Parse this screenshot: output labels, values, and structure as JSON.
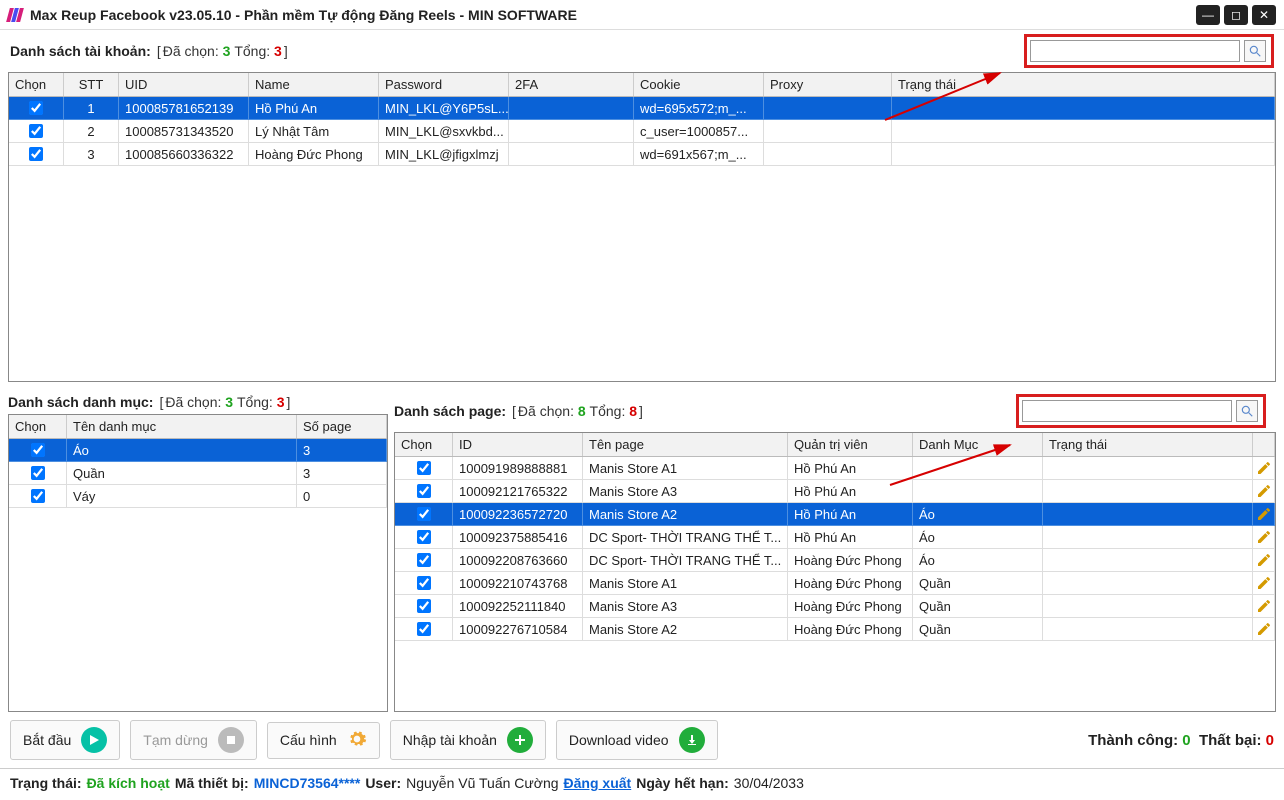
{
  "title": "Max Reup Facebook v23.05.10 - Phần mềm Tự động Đăng Reels - MIN SOFTWARE",
  "accounts_section": {
    "label": "Danh sách tài khoản:",
    "selected_label": "Đã chọn:",
    "selected_count": "3",
    "total_label": "Tổng:",
    "total_count": "3",
    "search_placeholder": ""
  },
  "accounts_headers": {
    "chon": "Chọn",
    "stt": "STT",
    "uid": "UID",
    "name": "Name",
    "password": "Password",
    "twofa": "2FA",
    "cookie": "Cookie",
    "proxy": "Proxy",
    "status": "Trạng thái"
  },
  "accounts": [
    {
      "stt": "1",
      "uid": "100085781652139",
      "name": "Hồ Phú An",
      "pass": "MIN_LKL@Y6P5sL...",
      "twofa": "",
      "cookie": "wd=695x572;m_...",
      "proxy": "",
      "status": "",
      "sel": true
    },
    {
      "stt": "2",
      "uid": "100085731343520",
      "name": "Lý Nhật Tâm",
      "pass": "MIN_LKL@sxvkbd...",
      "twofa": "",
      "cookie": "c_user=1000857...",
      "proxy": "",
      "status": "",
      "sel": false
    },
    {
      "stt": "3",
      "uid": "100085660336322",
      "name": "Hoàng Đức Phong",
      "pass": "MIN_LKL@jfigxlmzj",
      "twofa": "",
      "cookie": "wd=691x567;m_...",
      "proxy": "",
      "status": "",
      "sel": false
    }
  ],
  "cats_section": {
    "label": "Danh sách danh mục:",
    "selected_label": "Đã chọn:",
    "selected_count": "3",
    "total_label": "Tổng:",
    "total_count": "3"
  },
  "cats_headers": {
    "chon": "Chọn",
    "name": "Tên danh mục",
    "pages": "Số page"
  },
  "cats": [
    {
      "name": "Áo",
      "pages": "3",
      "sel": true
    },
    {
      "name": "Quần",
      "pages": "3",
      "sel": false
    },
    {
      "name": "Váy",
      "pages": "0",
      "sel": false
    }
  ],
  "pages_section": {
    "label": "Danh sách page:",
    "selected_label": "Đã chọn:",
    "selected_count": "8",
    "total_label": "Tổng:",
    "total_count": "8",
    "search_placeholder": ""
  },
  "pages_headers": {
    "chon": "Chọn",
    "id": "ID",
    "pname": "Tên page",
    "admin": "Quản trị viên",
    "danhmuc": "Danh Mục",
    "status": "Trạng thái"
  },
  "pages": [
    {
      "id": "100091989888881",
      "pname": "Manis Store A1",
      "admin": "Hồ Phú An",
      "danhmuc": "",
      "sel": false
    },
    {
      "id": "100092121765322",
      "pname": "Manis Store A3",
      "admin": "Hồ Phú An",
      "danhmuc": "",
      "sel": false
    },
    {
      "id": "100092236572720",
      "pname": "Manis Store A2",
      "admin": "Hồ Phú An",
      "danhmuc": "Áo",
      "sel": true
    },
    {
      "id": "100092375885416",
      "pname": "DC Sport- THỜI TRANG THỂ T...",
      "admin": "Hồ Phú An",
      "danhmuc": "Áo",
      "sel": false
    },
    {
      "id": "100092208763660",
      "pname": "DC Sport- THỜI TRANG THỂ T...",
      "admin": "Hoàng Đức Phong",
      "danhmuc": "Áo",
      "sel": false
    },
    {
      "id": "100092210743768",
      "pname": "Manis Store A1",
      "admin": "Hoàng Đức Phong",
      "danhmuc": "Quần",
      "sel": false
    },
    {
      "id": "100092252111840",
      "pname": "Manis Store A3",
      "admin": "Hoàng Đức Phong",
      "danhmuc": "Quần",
      "sel": false
    },
    {
      "id": "100092276710584",
      "pname": "Manis Store A2",
      "admin": "Hoàng Đức Phong",
      "danhmuc": "Quần",
      "sel": false
    }
  ],
  "toolbar": {
    "start": "Bắt đầu",
    "pause": "Tạm dừng",
    "config": "Cấu hình",
    "import": "Nhập tài khoản",
    "download": "Download video",
    "success_label": "Thành công:",
    "success_count": "0",
    "fail_label": "Thất bại:",
    "fail_count": "0"
  },
  "footer": {
    "status_lbl": "Trạng thái:",
    "status_val": "Đã kích hoạt",
    "device_lbl": "Mã thiết bị:",
    "device_val": "MINCD73564****",
    "user_lbl": "User:",
    "user_val": "Nguyễn Vũ Tuấn Cường",
    "logout": "Đăng xuất",
    "expire_lbl": "Ngày hết hạn:",
    "expire_val": "30/04/2033"
  }
}
